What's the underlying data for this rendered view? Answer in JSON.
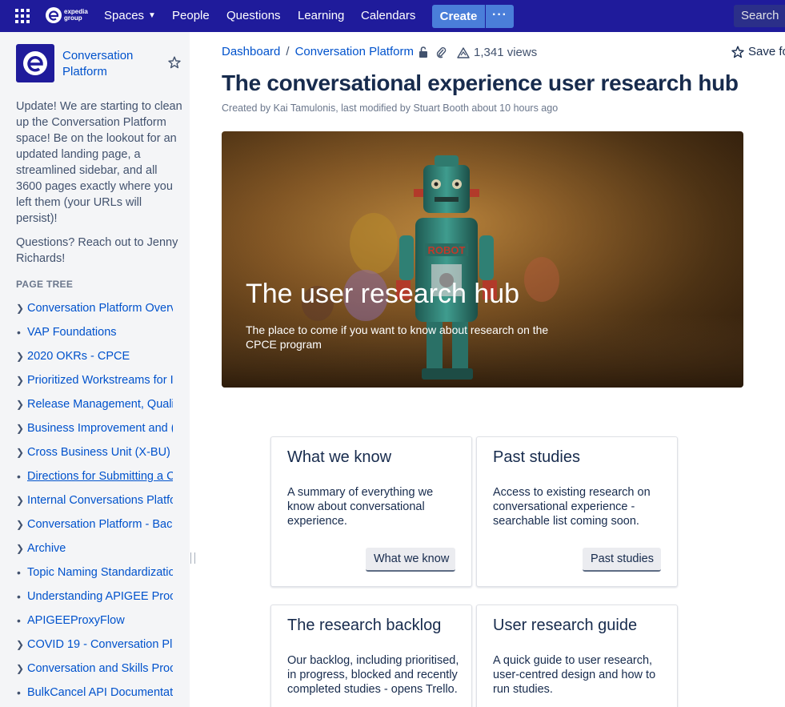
{
  "topnav": {
    "logo_text_line1": "expedia",
    "logo_text_line2": "group",
    "spaces": "Spaces",
    "people": "People",
    "questions": "Questions",
    "learning": "Learning",
    "calendars": "Calendars",
    "create": "Create",
    "more": "···",
    "search": "Search"
  },
  "sidebar": {
    "space_name": "Conversation Platform",
    "description": [
      "Update! We are starting to clean up the Conversation Platform space! Be on the lookout for an updated landing page, a streamlined sidebar, and all 3600 pages exactly where you left them (your URLs will persist)!",
      "Questions? Reach out to Jenny Richards!"
    ],
    "page_tree_heading": "PAGE TREE",
    "page_tree": [
      {
        "label": "Conversation Platform Overv",
        "marker": "chevron"
      },
      {
        "label": "VAP Foundations",
        "marker": "dot"
      },
      {
        "label": "2020 OKRs - CPCE",
        "marker": "chevron"
      },
      {
        "label": "Prioritized Workstreams for I",
        "marker": "chevron"
      },
      {
        "label": "Release Management, Qualit",
        "marker": "chevron"
      },
      {
        "label": "Business Improvement and (",
        "marker": "chevron"
      },
      {
        "label": "Cross Business Unit (X-BU)",
        "marker": "chevron"
      },
      {
        "label": "Directions for Submitting a C",
        "marker": "dot"
      },
      {
        "label": "Internal Conversations Platfo",
        "marker": "chevron"
      },
      {
        "label": "Conversation Platform - Bac",
        "marker": "chevron"
      },
      {
        "label": "Archive",
        "marker": "chevron"
      },
      {
        "label": "Topic Naming Standardizatio",
        "marker": "dot"
      },
      {
        "label": "Understanding APIGEE Proc",
        "marker": "dot"
      },
      {
        "label": "APIGEEProxyFlow",
        "marker": "dot"
      },
      {
        "label": "COVID 19 - Conversation Pla",
        "marker": "chevron"
      },
      {
        "label": "Conversation and Skills Proc",
        "marker": "chevron"
      },
      {
        "label": "BulkCancel API Documentat",
        "marker": "dot"
      }
    ]
  },
  "main": {
    "breadcrumb": [
      "Dashboard",
      "Conversation Platform"
    ],
    "views": "1,341 views",
    "save_for_later": "Save fo",
    "title": "The conversational experience user research hub",
    "byline": "Created by Kai Tamulonis, last modified by Stuart Booth about 10 hours ago",
    "hero": {
      "title": "The user research hub",
      "subtitle": "The place to come if you want to know about research on the CPCE program",
      "robot_text": "ROBOT"
    },
    "cards": [
      {
        "title": "What we know",
        "description": "A summary of everything we know about conversational experience.",
        "button": "What we know"
      },
      {
        "title": "Past studies",
        "description": "Access to existing research on conversational experience - searchable list coming soon.",
        "button": "Past studies"
      },
      {
        "title": "The research backlog",
        "description": "Our backlog, including prioritised, in progress, blocked and recently completed studies - opens Trello.",
        "button": ""
      },
      {
        "title": "User research guide",
        "description": "A quick guide to user research, user-centred design and how to run studies.",
        "button": ""
      }
    ]
  },
  "colors": {
    "nav_bg": "#1f1b9b",
    "create_button": "#4a7ed9",
    "link": "#0052cc",
    "sidebar_bg": "#f4f5f7"
  }
}
